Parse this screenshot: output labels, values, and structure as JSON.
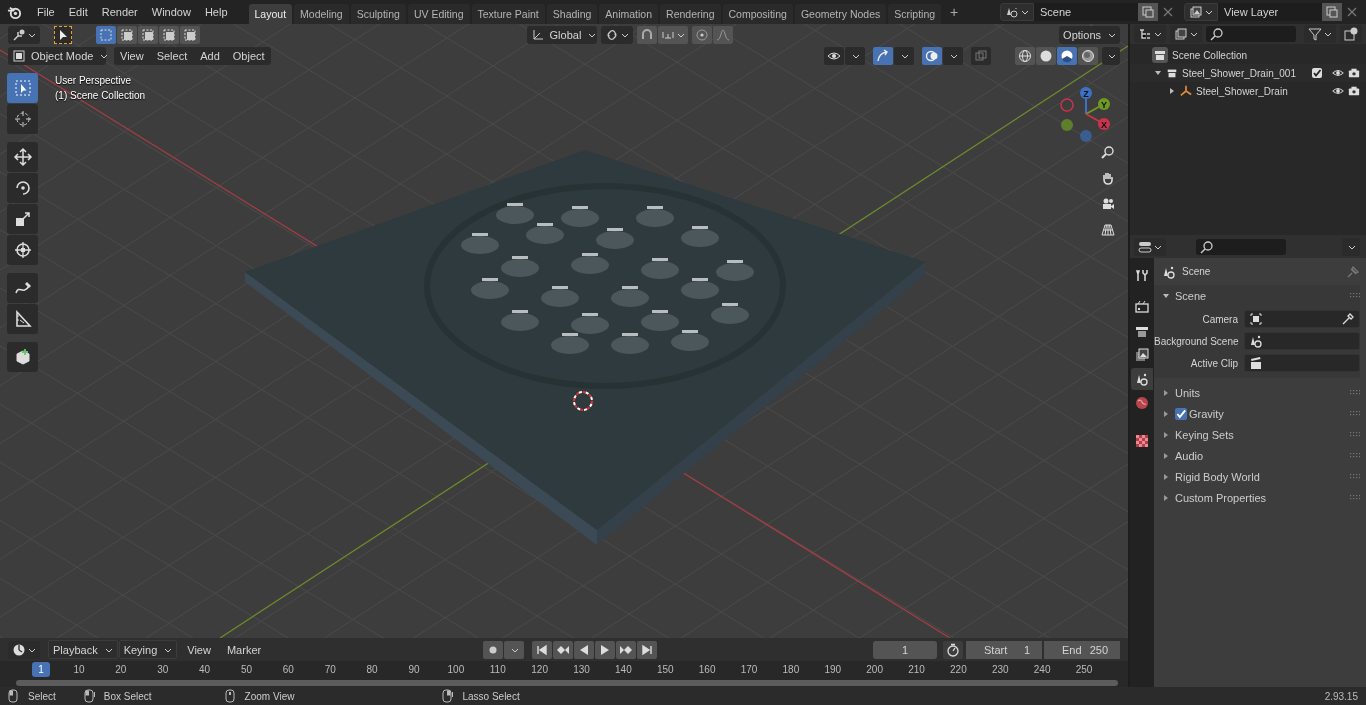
{
  "menu_bar": {
    "menus": [
      "File",
      "Edit",
      "Render",
      "Window",
      "Help"
    ]
  },
  "workspace_tabs": [
    {
      "label": "Layout",
      "selected": true
    },
    {
      "label": "Modeling",
      "selected": false
    },
    {
      "label": "Sculpting",
      "selected": false
    },
    {
      "label": "UV Editing",
      "selected": false
    },
    {
      "label": "Texture Paint",
      "selected": false
    },
    {
      "label": "Shading",
      "selected": false
    },
    {
      "label": "Animation",
      "selected": false
    },
    {
      "label": "Rendering",
      "selected": false
    },
    {
      "label": "Compositing",
      "selected": false
    },
    {
      "label": "Geometry Nodes",
      "selected": false
    },
    {
      "label": "Scripting",
      "selected": false
    }
  ],
  "add_tab": "+",
  "scene_selector": {
    "value": "Scene"
  },
  "view_layer_selector": {
    "value": "View Layer"
  },
  "viewport": {
    "selection_modes": [
      {
        "selected": true
      },
      {
        "selected": false
      },
      {
        "selected": false
      },
      {
        "selected": false
      },
      {
        "selected": false
      }
    ],
    "transform_orientation": "Global",
    "options_button": "Options",
    "mode": "Object Mode",
    "menus": [
      "View",
      "Select",
      "Add",
      "Object"
    ],
    "toggles": [
      {
        "kind": "visibility",
        "on": false
      },
      {
        "kind": "gizmo",
        "on": true
      },
      {
        "kind": "overlay",
        "on": true
      },
      {
        "kind": "xray",
        "on": false
      }
    ],
    "shading": [
      {
        "kind": "wireframe",
        "selected": false
      },
      {
        "kind": "solid",
        "selected": false
      },
      {
        "kind": "material",
        "selected": true
      },
      {
        "kind": "rendered",
        "selected": false
      }
    ],
    "overlay_lines": [
      "User Perspective",
      "(1) Scene Collection"
    ],
    "tool_groups": [
      [
        {
          "kind": "select",
          "selected": true
        },
        {
          "kind": "cursor",
          "selected": false
        }
      ],
      [
        {
          "kind": "move",
          "selected": false
        },
        {
          "kind": "rotate",
          "selected": false
        },
        {
          "kind": "scale",
          "selected": false
        },
        {
          "kind": "transform",
          "selected": false
        }
      ],
      [
        {
          "kind": "annotate",
          "selected": false
        },
        {
          "kind": "measure",
          "selected": false
        }
      ],
      [
        {
          "kind": "add_cube",
          "selected": false
        }
      ]
    ],
    "gizmo_labels": {
      "z": "Z",
      "y": "Y",
      "x": "X"
    }
  },
  "outliner": {
    "items": [
      {
        "label": "Scene Collection",
        "kind": "scene_collection",
        "children": [
          {
            "label": "Steel_Shower_Drain_001",
            "kind": "collection",
            "expanded": true,
            "checked": true,
            "children": [
              {
                "label": "Steel_Shower_Drain",
                "kind": "object",
                "expanded": false
              }
            ]
          }
        ]
      }
    ]
  },
  "properties": {
    "tabs": [
      {
        "kind": "tool",
        "selected": false
      },
      {
        "kind": "render",
        "selected": false
      },
      {
        "kind": "output",
        "selected": false
      },
      {
        "kind": "view_layer",
        "selected": false
      },
      {
        "kind": "scene",
        "selected": true
      },
      {
        "kind": "world",
        "selected": false
      },
      {
        "kind": "texture",
        "selected": false
      }
    ],
    "context": "Scene",
    "panel": {
      "title": "Scene",
      "expanded": true,
      "fields": [
        {
          "label": "Camera",
          "kind": "camera"
        },
        {
          "label": "Background Scene",
          "kind": "scene"
        },
        {
          "label": "Active Clip",
          "kind": "clip"
        }
      ]
    },
    "sections": [
      {
        "label": "Units",
        "expanded": false
      },
      {
        "label": "Gravity",
        "expanded": false,
        "checked": true
      },
      {
        "label": "Keying Sets",
        "expanded": false
      },
      {
        "label": "Audio",
        "expanded": false
      },
      {
        "label": "Rigid Body World",
        "expanded": false
      },
      {
        "label": "Custom Properties",
        "expanded": false
      }
    ]
  },
  "timeline": {
    "menus": [
      "Playback",
      "Keying"
    ],
    "plain_menus": [
      "View",
      "Marker"
    ],
    "current_frame": "1",
    "start_label": "Start",
    "start": "1",
    "end_label": "End",
    "end": "250",
    "playhead": "1",
    "ruler_labels": [
      "10",
      "20",
      "30",
      "40",
      "50",
      "60",
      "70",
      "80",
      "90",
      "100",
      "110",
      "120",
      "130",
      "140",
      "150",
      "160",
      "170",
      "180",
      "190",
      "200",
      "210",
      "220",
      "230",
      "240",
      "250"
    ]
  },
  "status_bar": {
    "hints": [
      {
        "kind": "left",
        "label": "Select"
      },
      {
        "kind": "left_drag",
        "label": "Box Select"
      },
      {
        "kind": "middle",
        "label": "Zoom View"
      },
      {
        "kind": "right_drag",
        "label": "Lasso Select"
      }
    ],
    "version": "2.93.15"
  }
}
